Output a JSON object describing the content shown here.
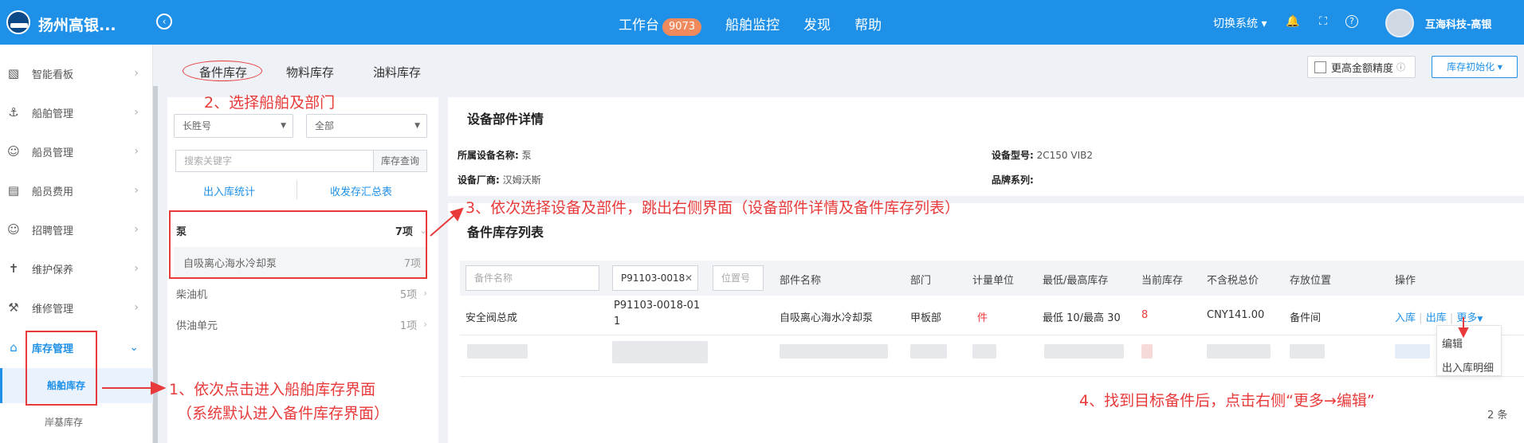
{
  "header": {
    "brand": "扬州高银...",
    "nav": [
      {
        "label": "工作台",
        "badge": "9073"
      },
      {
        "label": "船舶监控"
      },
      {
        "label": "发现"
      },
      {
        "label": "帮助"
      }
    ],
    "switch_system": "切换系统",
    "username": "互海科技-高银"
  },
  "sidebar": {
    "items": [
      {
        "label": "智能看板",
        "icon": "chart-icon"
      },
      {
        "label": "船舶管理",
        "icon": "anchor-icon"
      },
      {
        "label": "船员管理",
        "icon": "person-icon"
      },
      {
        "label": "船员费用",
        "icon": "wallet-icon"
      },
      {
        "label": "招聘管理",
        "icon": "recruit-icon"
      },
      {
        "label": "维护保养",
        "icon": "tool-icon"
      },
      {
        "label": "维修管理",
        "icon": "wrench-icon"
      },
      {
        "label": "库存管理",
        "icon": "home-icon"
      }
    ],
    "sub_items": [
      "船舶库存",
      "岸基库存"
    ]
  },
  "tabs": [
    "备件库存",
    "物料库存",
    "油料库存"
  ],
  "toolbar": {
    "precision": "更高金额精度",
    "init": "库存初始化"
  },
  "filter": {
    "ship": "长胜号",
    "dept": "全部",
    "search_placeholder": "搜索关键字",
    "search_btn": "库存查询",
    "link_inout": "出入库统计",
    "link_summary": "收发存汇总表"
  },
  "tree": [
    {
      "name": "泵",
      "count": "7项"
    },
    {
      "name": "自吸离心海水冷却泵",
      "count": "7项"
    },
    {
      "name": "柴油机",
      "count": "5项"
    },
    {
      "name": "供油单元",
      "count": "1项"
    }
  ],
  "detail": {
    "title": "设备部件详情",
    "device_name_label": "所属设备名称:",
    "device_name": "泵",
    "model_label": "设备型号:",
    "model": "2C150 VIB2",
    "maker_label": "设备厂商:",
    "maker": "汉姆沃斯",
    "brand_label": "品牌系列:"
  },
  "list": {
    "title": "备件库存列表",
    "name_placeholder": "备件名称",
    "code_value": "P91103-0018",
    "location_placeholder": "位置号",
    "columns": [
      "部件名称",
      "部门",
      "计量单位",
      "最低/最高库存",
      "当前库存",
      "不含税总价",
      "存放位置",
      "操作"
    ],
    "row": {
      "name": "安全阀总成",
      "code": "P91103-0018-01",
      "code_wrap": "1",
      "part": "自吸离心海水冷却泵",
      "dept": "甲板部",
      "unit": "件",
      "minmax": "最低 10/最高 30",
      "current": "8",
      "price": "CNY141.00",
      "location": "备件间"
    },
    "ops": {
      "in": "入库",
      "out": "出库",
      "more": "更多"
    },
    "dropdown": [
      "编辑",
      "出入库明细"
    ],
    "total": "2 条"
  },
  "annotations": {
    "a1": "1、依次点击进入船舶库存界面",
    "a1b": "（系统默认进入备件库存界面）",
    "a2": "2、选择船舶及部门",
    "a3": "3、依次选择设备及部件，跳出右侧界面（设备部件详情及备件库存列表）",
    "a4": "4、找到目标备件后，点击右侧“更多→编辑”"
  },
  "colors": {
    "primary": "#1e90e8",
    "annotation": "#e83a3a",
    "badge": "#f08a5d"
  }
}
